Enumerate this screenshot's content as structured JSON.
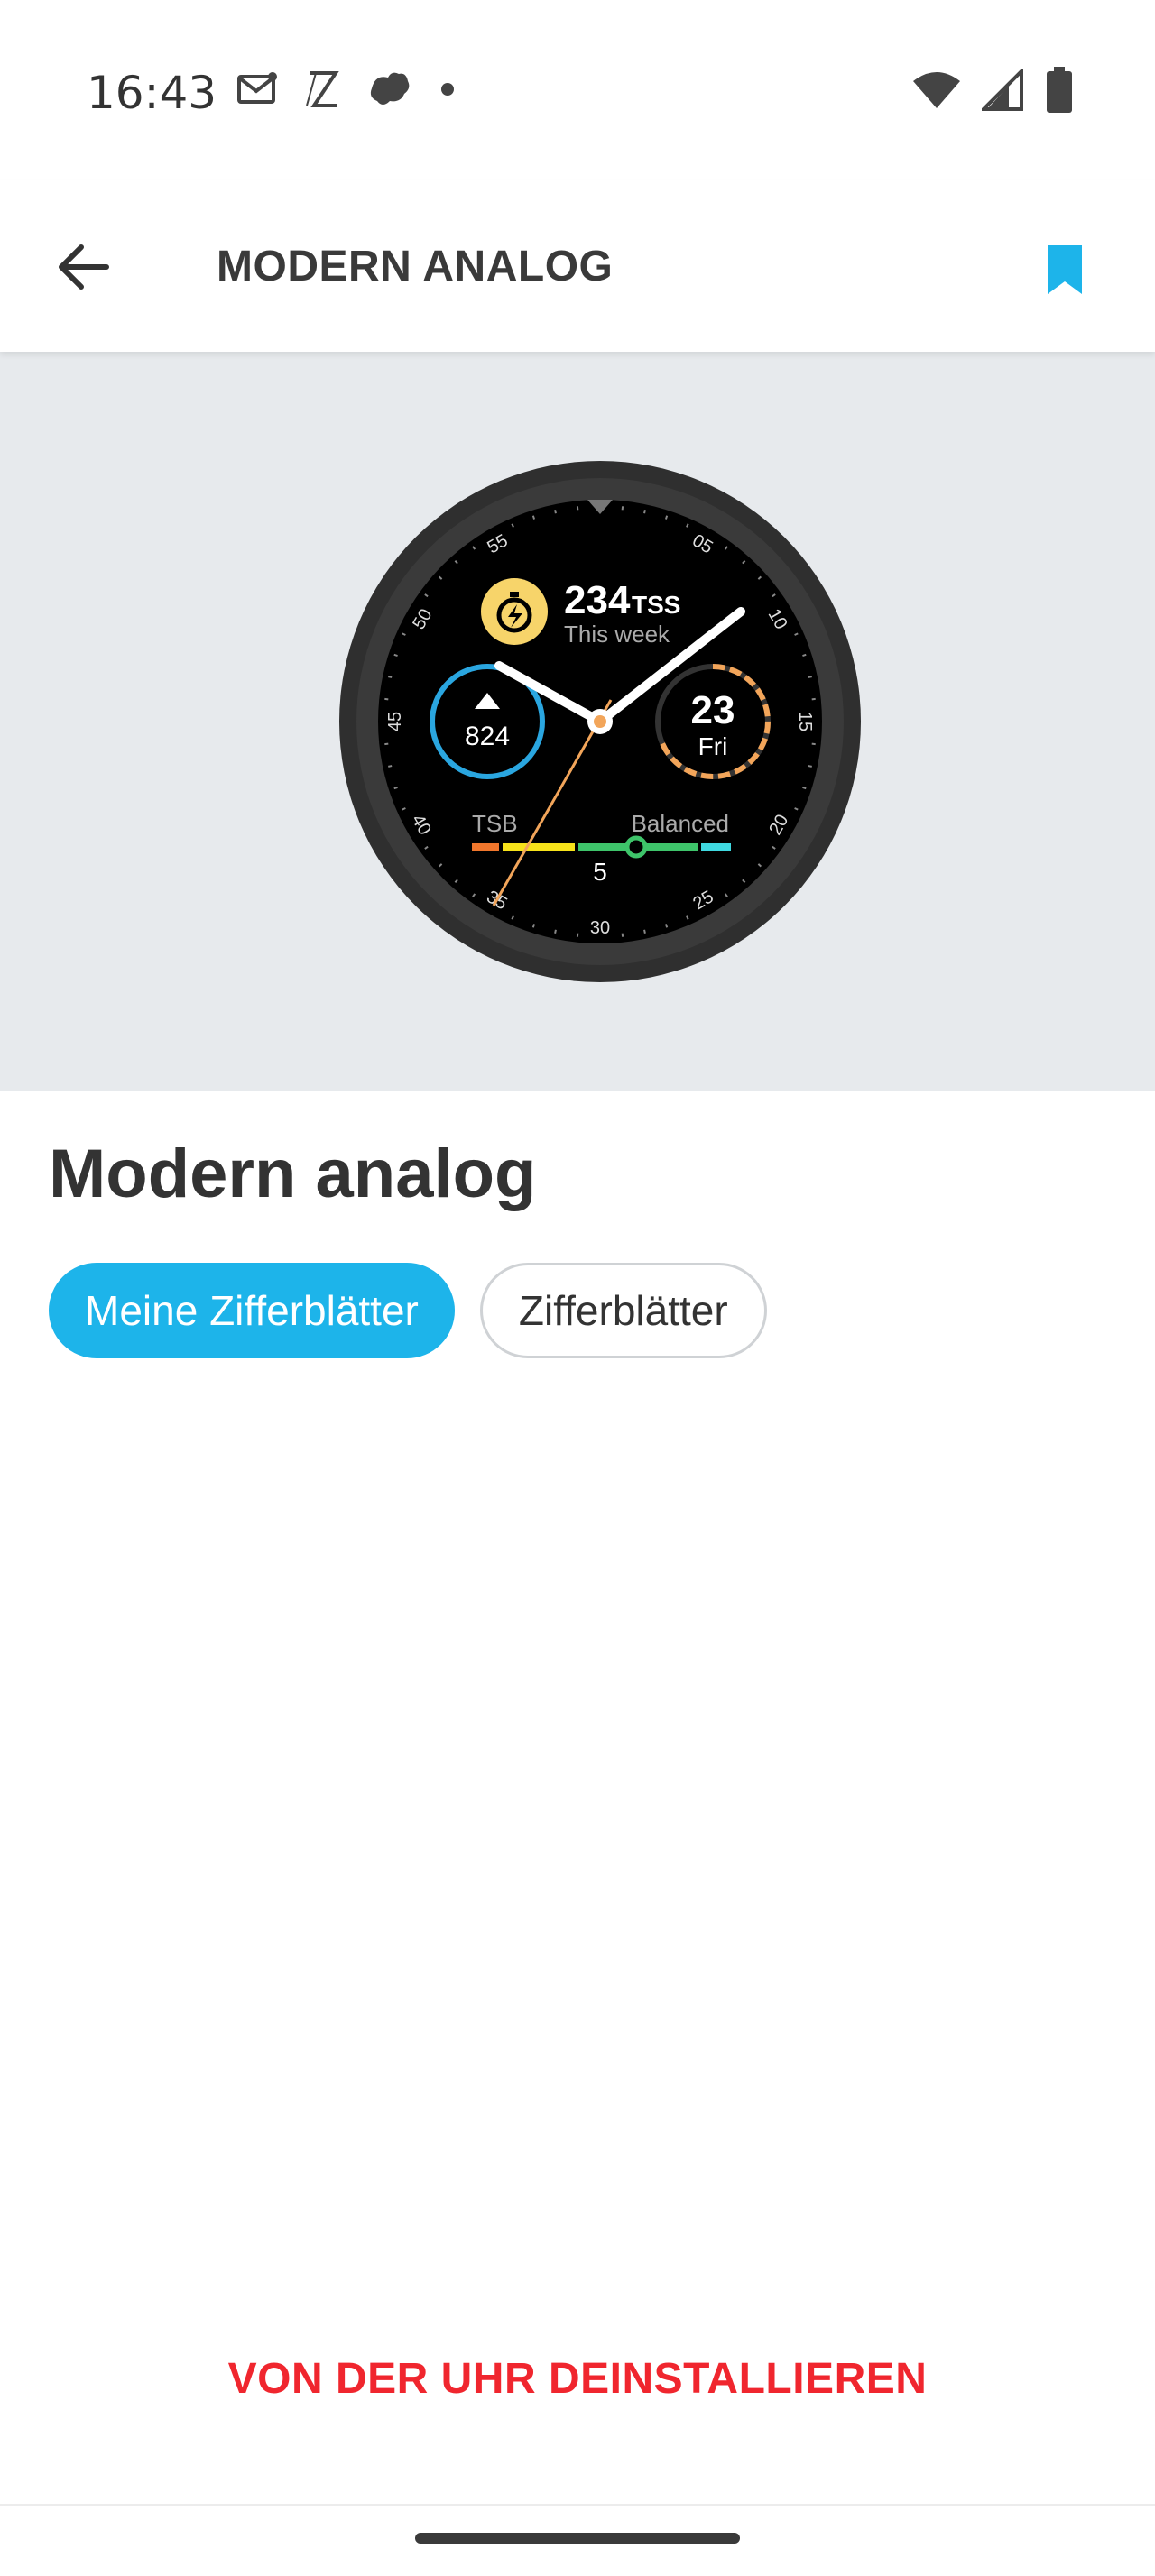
{
  "status_bar": {
    "time": "16:43",
    "left_icons": [
      "gmail-icon",
      "z-app-icon",
      "bird-app-icon",
      "notification-dot-icon"
    ],
    "right_icons": [
      "wifi-icon",
      "signal-icon",
      "battery-icon"
    ]
  },
  "app_bar": {
    "title": "MODERN ANALOG",
    "back_icon": "arrow-left-icon",
    "bookmark_icon": "bookmark-icon",
    "accent": "#1db4ea"
  },
  "watch_face": {
    "tss_value": "234",
    "tss_unit": "TSS",
    "tss_period": "This week",
    "ascent_value": "824",
    "date_day": "23",
    "date_weekday": "Fri",
    "tsb_label": "TSB",
    "tsb_status": "Balanced",
    "tsb_value": "5",
    "dial_numbers": [
      "05",
      "10",
      "15",
      "20",
      "25",
      "30",
      "35",
      "40",
      "45",
      "50",
      "55"
    ]
  },
  "content": {
    "face_name": "Modern analog",
    "chips": [
      {
        "label": "Meine Zifferblätter",
        "active": true
      },
      {
        "label": "Zifferblätter",
        "active": false
      }
    ],
    "uninstall_label": "VON DER UHR DEINSTALLIEREN",
    "uninstall_color": "#f0262e"
  }
}
